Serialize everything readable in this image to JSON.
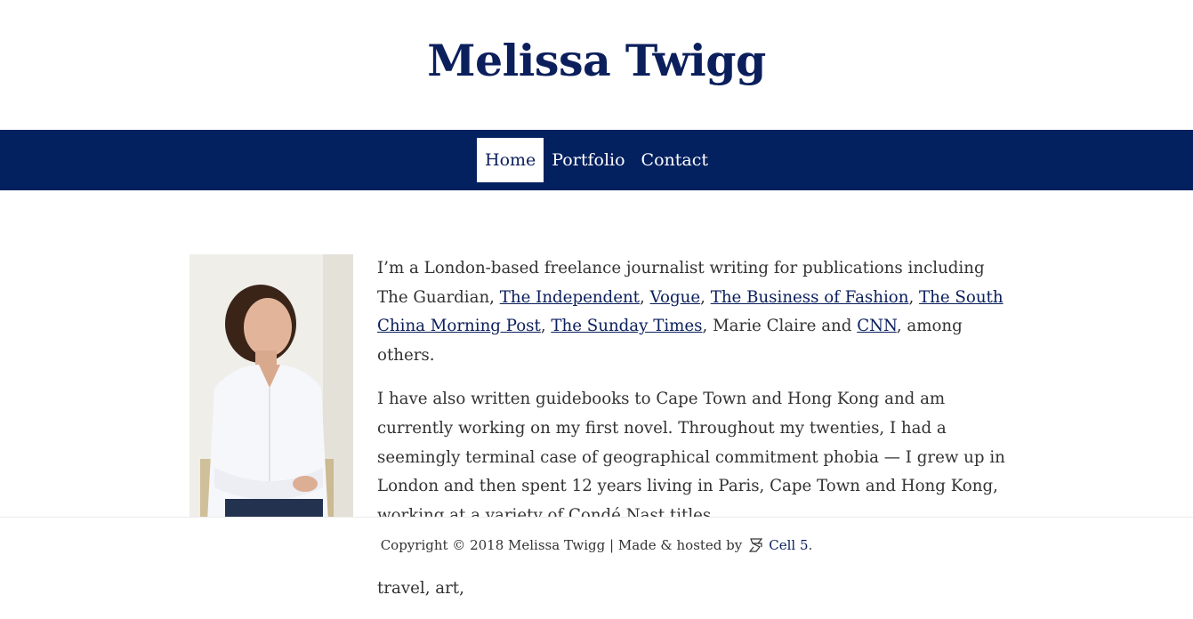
{
  "site": {
    "title": "Melissa Twigg"
  },
  "nav": {
    "items": [
      {
        "label": "Home",
        "active": true
      },
      {
        "label": "Portfolio",
        "active": false
      },
      {
        "label": "Contact",
        "active": false
      }
    ]
  },
  "bio": {
    "p1": {
      "t1": "I’m a London-based freelance journalist writing for publications including The Guardian, ",
      "independent": "The Independent",
      "s1": ", ",
      "vogue": "Vogue",
      "s2": ", ",
      "bof": "The Business of Fashion",
      "s3": ", ",
      "scmp": "The South China Morning Post",
      "s4": ", ",
      "sunday_times": "The Sunday Times",
      "t2": ", Marie Claire and ",
      "cnn": "CNN",
      "t3": ", among others."
    },
    "p2": "I have also written guidebooks to Cape Town and Hong Kong and am currently working on my first novel. Throughout my twenties, I had a seemingly terminal case of geographical commitment phobia — I grew up in London and then spent 12 years living in Paris, Cape Town and Hong Kong, working at a variety of Condé Nast titles.",
    "p3": "Freelance journalists need a speciality. But after a decade of writing about travel, art,"
  },
  "footer": {
    "text": "Copyright © 2018 Melissa Twigg | Made & hosted by",
    "link_label": "Cell 5",
    "period": ".",
    "logo_icon": "cell5-logo-icon"
  },
  "colors": {
    "brand_navy": "#03205f",
    "title_navy": "#0b1f5c"
  }
}
